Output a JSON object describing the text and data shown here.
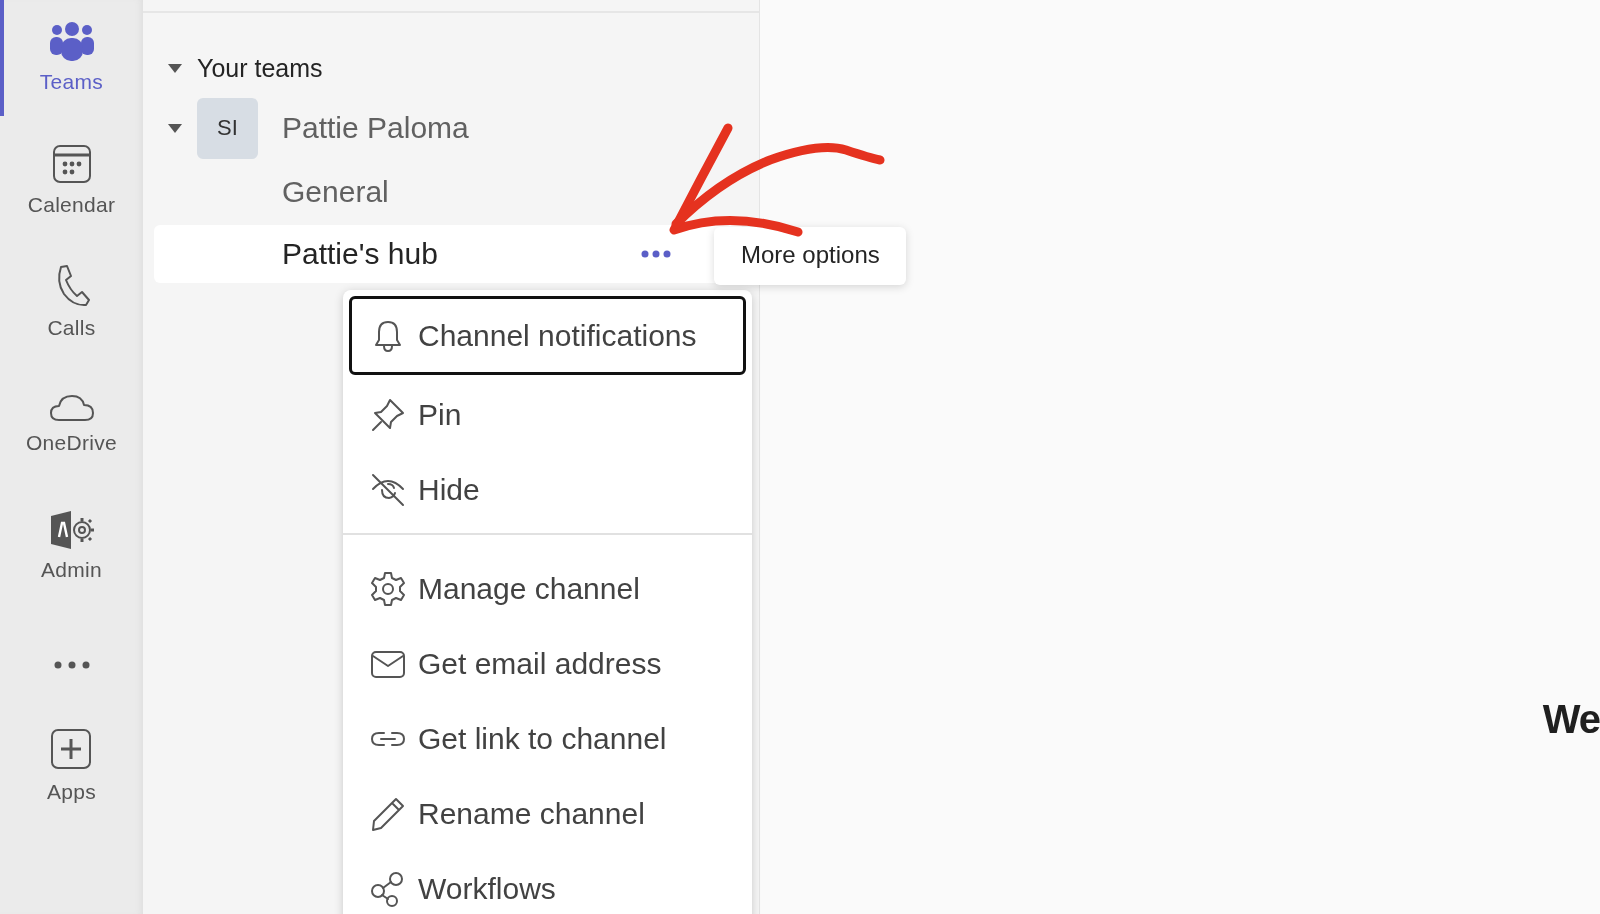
{
  "rail": {
    "items": [
      {
        "label": "Teams",
        "selected": true
      },
      {
        "label": "Calendar",
        "selected": false
      },
      {
        "label": "Calls",
        "selected": false
      },
      {
        "label": "OneDrive",
        "selected": false
      },
      {
        "label": "Admin",
        "selected": false
      }
    ],
    "apps": {
      "label": "Apps"
    }
  },
  "panel": {
    "section": {
      "label": "Your teams",
      "expanded": true
    },
    "team": {
      "initials": "SI",
      "name": "Pattie Paloma",
      "expanded": true,
      "channels": [
        {
          "name": "General",
          "selected": false
        },
        {
          "name": "Pattie's hub",
          "selected": true
        }
      ]
    }
  },
  "tooltip": {
    "text": "More options"
  },
  "menu": {
    "groups": [
      [
        {
          "label": "Channel notifications",
          "focused": true
        },
        {
          "label": "Pin",
          "focused": false
        },
        {
          "label": "Hide",
          "focused": false
        }
      ],
      [
        {
          "label": "Manage channel",
          "focused": false
        },
        {
          "label": "Get email address",
          "focused": false
        },
        {
          "label": "Get link to channel",
          "focused": false
        },
        {
          "label": "Rename channel",
          "focused": false
        },
        {
          "label": "Workflows",
          "focused": false
        }
      ]
    ]
  },
  "main": {
    "heading": "We"
  }
}
